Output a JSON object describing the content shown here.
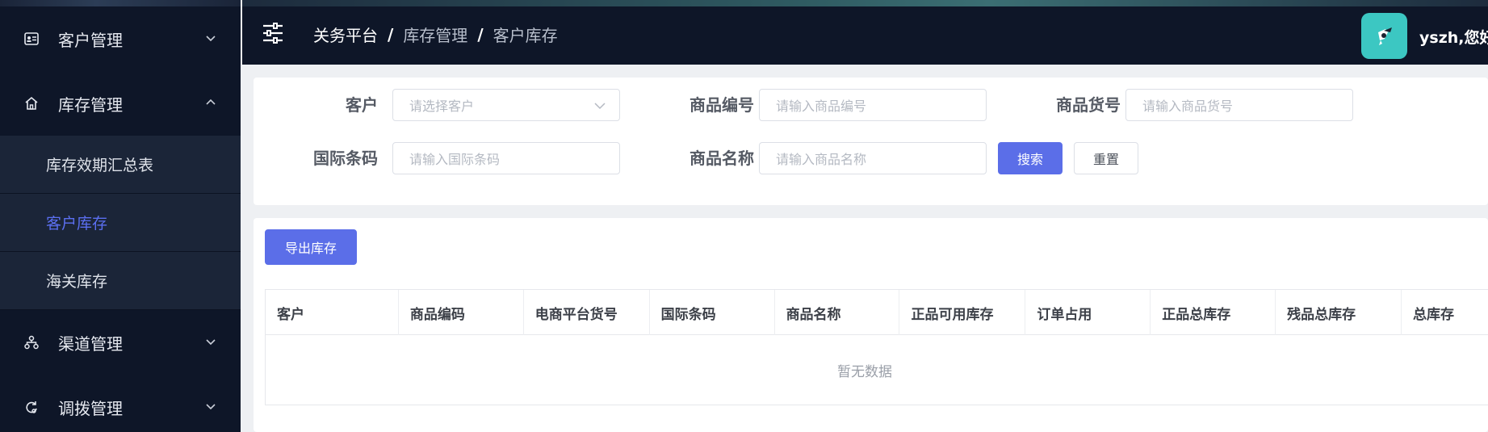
{
  "sidebar": {
    "groups": [
      {
        "label": "客户管理",
        "icon": "id-card-icon",
        "expanded": false
      },
      {
        "label": "库存管理",
        "icon": "home-icon",
        "expanded": true,
        "items": [
          {
            "label": "库存效期汇总表",
            "active": false
          },
          {
            "label": "客户库存",
            "active": true
          },
          {
            "label": "海关库存",
            "active": false
          }
        ]
      },
      {
        "label": "渠道管理",
        "icon": "hierarchy-icon",
        "expanded": false
      },
      {
        "label": "调拨管理",
        "icon": "transfer-icon",
        "expanded": false
      }
    ]
  },
  "header": {
    "breadcrumb": [
      "关务平台",
      "库存管理",
      "客户库存"
    ],
    "separator": "/",
    "username": "yszh,您好"
  },
  "search": {
    "customer_label": "客户",
    "customer_placeholder": "请选择客户",
    "product_code_label": "商品编号",
    "product_code_placeholder": "请输入商品编号",
    "product_sku_label": "商品货号",
    "product_sku_placeholder": "请输入商品货号",
    "barcode_label": "国际条码",
    "barcode_placeholder": "请输入国际条码",
    "product_name_label": "商品名称",
    "product_name_placeholder": "请输入商品名称",
    "search_button": "搜索",
    "reset_button": "重置"
  },
  "toolbar": {
    "export_button": "导出库存"
  },
  "table": {
    "columns": [
      "客户",
      "商品编码",
      "电商平台货号",
      "国际条码",
      "商品名称",
      "正品可用库存",
      "订单占用",
      "正品总库存",
      "残品总库存",
      "总库存"
    ],
    "empty_text": "暂无数据"
  },
  "colors": {
    "sidebar_bg": "#0e1628",
    "accent": "#5b6ee8",
    "avatar_bg": "#3cc7c2"
  }
}
